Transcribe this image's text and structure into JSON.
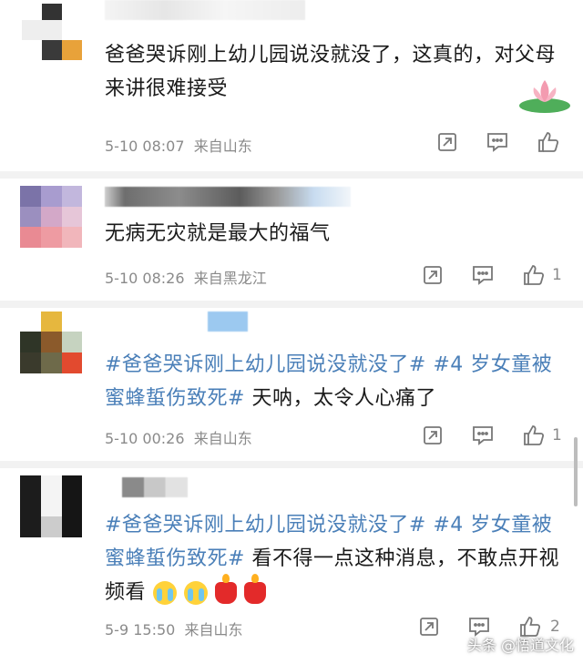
{
  "comments": [
    {
      "text": "爸爸哭诉刚上幼儿园说没就没了，这真的，对父母来讲很难接受",
      "time": "5-10 08:07",
      "location": "来自山东",
      "likes": ""
    },
    {
      "text": "无病无灾就是最大的福气",
      "time": "5-10 08:26",
      "location": "来自黑龙江",
      "likes": "1"
    },
    {
      "hashtags": [
        "#爸爸哭诉刚上幼儿园说没就没了#",
        "#4 岁女童被蜜蜂蜇伤致死#"
      ],
      "text": "天呐，太令人心痛了",
      "time": "5-10 00:26",
      "location": "来自山东",
      "likes": "1"
    },
    {
      "hashtags": [
        "#爸爸哭诉刚上幼儿园说没就没了#",
        "#4 岁女童被蜜蜂蜇伤致死#"
      ],
      "text": "看不得一点这种消息，不敢点开视频看",
      "emojis": [
        "crying-emoji",
        "crying-emoji",
        "candle-emoji",
        "candle-emoji"
      ],
      "time": "5-9 15:50",
      "location": "来自山东",
      "likes": "2"
    }
  ],
  "watermark": "头条 @悟道文化",
  "colors": {
    "hashtag": "#4a7fb8",
    "meta": "#8a8a8a",
    "divider": "#f2f2f2"
  }
}
